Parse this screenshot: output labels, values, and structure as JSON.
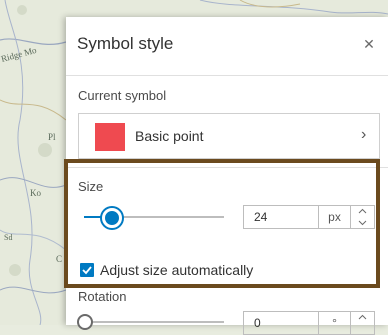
{
  "map": {
    "labels": [
      "Ridge Mo",
      "Pl",
      "Sd",
      "Ko",
      "C"
    ]
  },
  "panel": {
    "title": "Symbol style",
    "close_icon": "close-icon",
    "current_symbol": {
      "label": "Current symbol",
      "name": "Basic point",
      "swatch_color": "#ef4a50"
    },
    "size": {
      "label": "Size",
      "value": "24",
      "unit": "px",
      "slider_fraction": 0.2
    },
    "adjust": {
      "label": "Adjust size automatically",
      "checked": true
    },
    "rotation": {
      "label": "Rotation",
      "value": "0",
      "unit": "°",
      "slider_fraction": 0
    }
  },
  "colors": {
    "accent": "#007ac2",
    "highlight": "#6b4a1e"
  }
}
